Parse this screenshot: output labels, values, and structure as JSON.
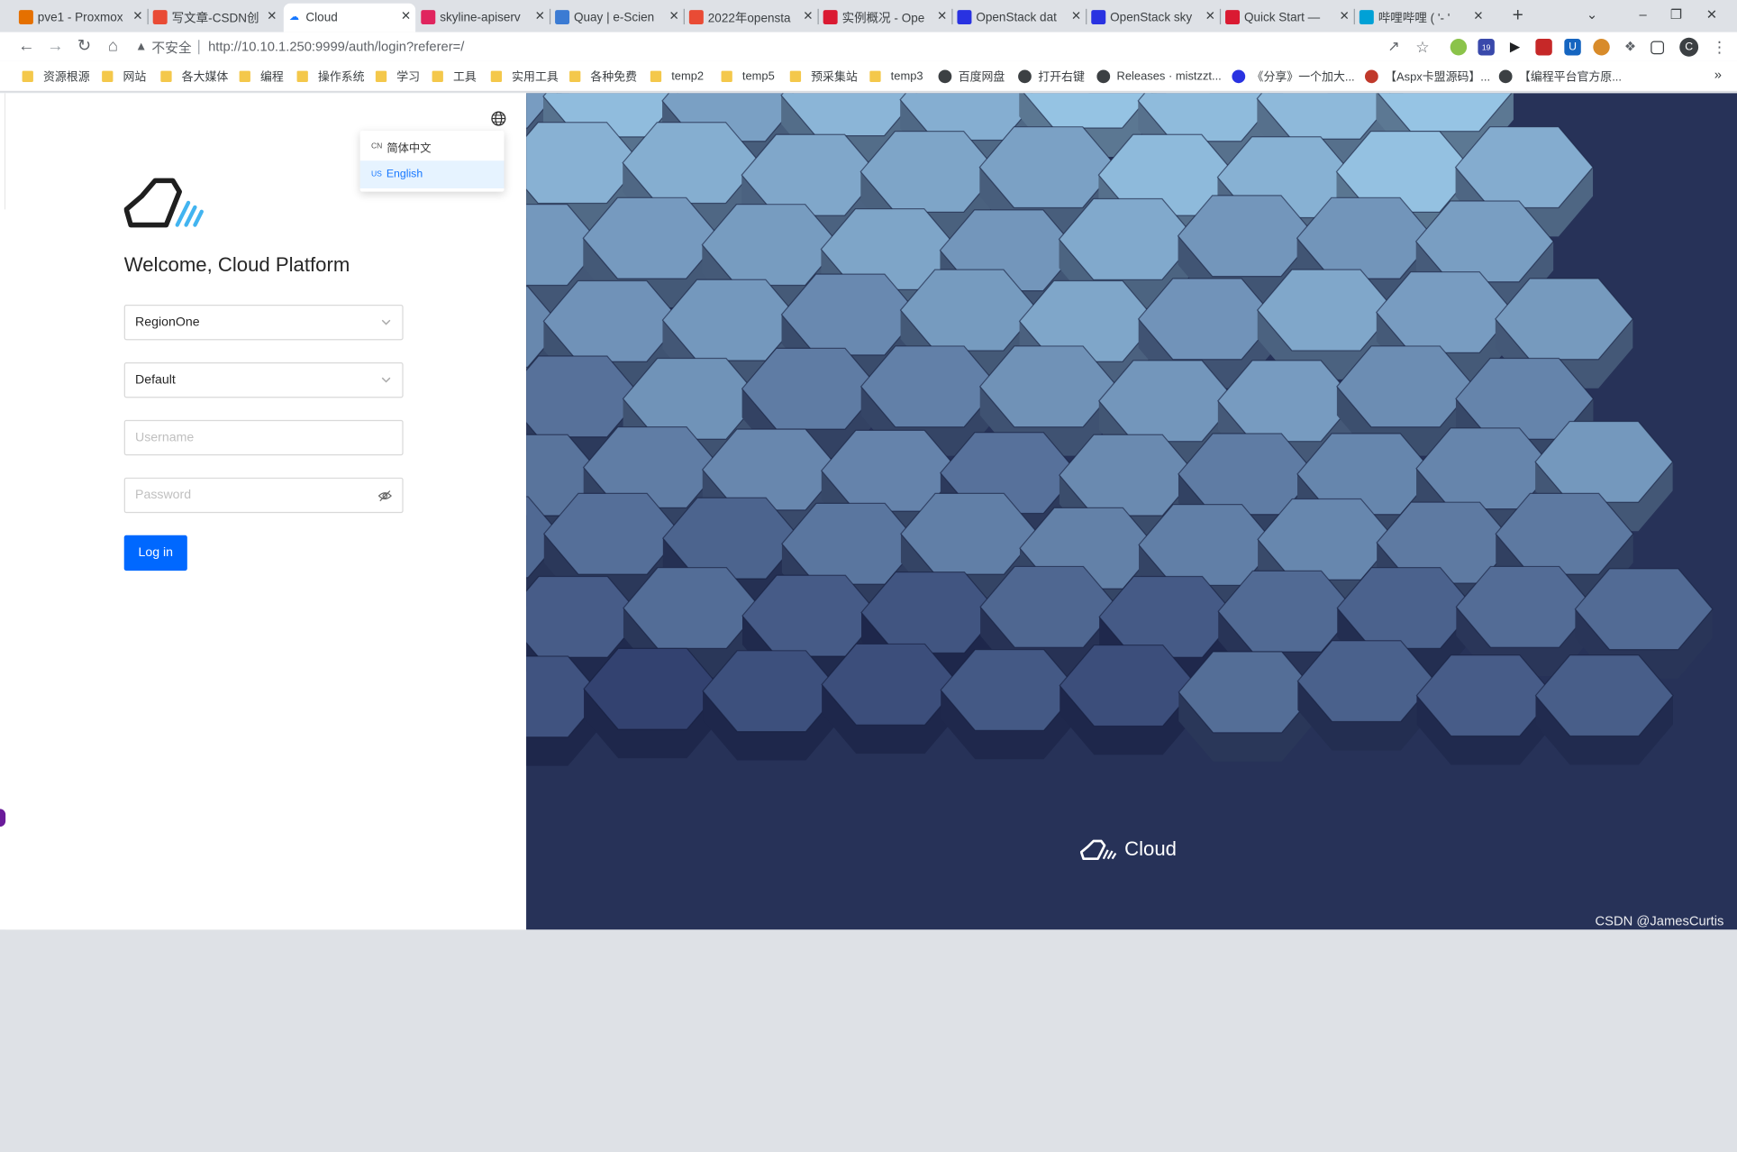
{
  "browser": {
    "tabs": [
      {
        "title": "pve1 - Proxmox",
        "icon": "proxmox-icon",
        "color": "#e57000"
      },
      {
        "title": "写文章-CSDN创",
        "icon": "csdn-icon",
        "color": "#e94b35"
      },
      {
        "title": "Cloud",
        "icon": "cloud-icon",
        "color": "#1677ff",
        "active": true
      },
      {
        "title": "skyline-apiserv",
        "icon": "skyline-icon",
        "color": "#e0245e"
      },
      {
        "title": "Quay | e-Scien",
        "icon": "quay-icon",
        "color": "#3b7bd3"
      },
      {
        "title": "2022年opensta",
        "icon": "csdn-icon",
        "color": "#e94b35"
      },
      {
        "title": "实例概况 - Ope",
        "icon": "openstack-icon",
        "color": "#da1a32"
      },
      {
        "title": "OpenStack dat",
        "icon": "baidu-icon",
        "color": "#2932e1"
      },
      {
        "title": "OpenStack sky",
        "icon": "baidu-icon",
        "color": "#2932e1"
      },
      {
        "title": "Quick Start —",
        "icon": "openstack-icon",
        "color": "#da1a32"
      },
      {
        "title": "哔哩哔哩 ( '- '",
        "icon": "bilibili-icon",
        "color": "#00a1d6"
      }
    ],
    "new_tab": "+",
    "address": {
      "insecure_label": "不安全",
      "url": "http://10.10.1.250:9999/auth/login?referer=/"
    },
    "bookmarks": [
      {
        "label": "资源根源",
        "kind": "folder"
      },
      {
        "label": "网站",
        "kind": "folder"
      },
      {
        "label": "各大媒体",
        "kind": "folder"
      },
      {
        "label": "编程",
        "kind": "folder"
      },
      {
        "label": "操作系统",
        "kind": "folder"
      },
      {
        "label": "学习",
        "kind": "folder"
      },
      {
        "label": "工具",
        "kind": "folder"
      },
      {
        "label": "实用工具",
        "kind": "folder"
      },
      {
        "label": "各种免费",
        "kind": "folder"
      },
      {
        "label": "temp2",
        "kind": "folder"
      },
      {
        "label": "temp5",
        "kind": "folder"
      },
      {
        "label": "预采集站",
        "kind": "folder"
      },
      {
        "label": "temp3",
        "kind": "folder"
      },
      {
        "label": "百度网盘",
        "kind": "globe"
      },
      {
        "label": "打开右键",
        "kind": "globe"
      },
      {
        "label": "Releases · mistzzt...",
        "kind": "github"
      },
      {
        "label": "《分享》一个加大...",
        "kind": "baidu"
      },
      {
        "label": "【Aspx卡盟源码】...",
        "kind": "site"
      },
      {
        "label": "【编程平台官方原...",
        "kind": "globe"
      }
    ],
    "bookmarks_more": "»",
    "ext_badge": "19",
    "profile_initial": "C"
  },
  "login": {
    "language_options": [
      {
        "code": "CN",
        "label": "简体中文"
      },
      {
        "code": "US",
        "label": "English",
        "selected": true
      }
    ],
    "welcome": "Welcome, Cloud Platform",
    "region_value": "RegionOne",
    "domain_value": "Default",
    "username_placeholder": "Username",
    "password_placeholder": "Password",
    "login_button": "Log in"
  },
  "hero": {
    "brand_name": "Cloud",
    "watermark": "CSDN @JamesCurtis"
  },
  "colors": {
    "primary": "#0068ff",
    "hero_bg": "#2a3560",
    "hex_light": "#8fb4d4"
  }
}
